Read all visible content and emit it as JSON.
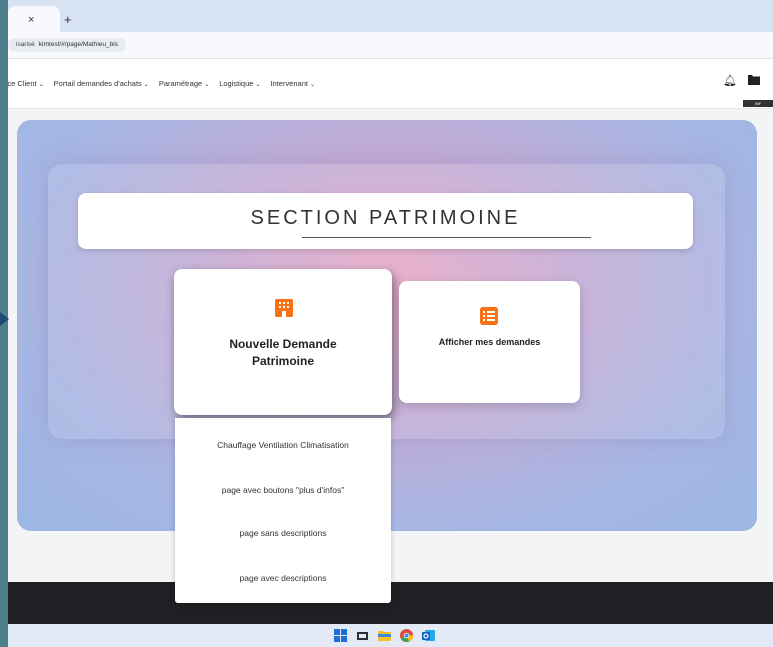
{
  "browser": {
    "tab_close": "×",
    "tab_new": "+",
    "address_prefix": "isarisé",
    "url": "kimtest/#/page/Mathieu_bis"
  },
  "nav": {
    "items": [
      {
        "label": "vice Client"
      },
      {
        "label": "Portail demandes d'achats"
      },
      {
        "label": "Paramétrage"
      },
      {
        "label": "Logistique"
      },
      {
        "label": "Intervenant"
      }
    ],
    "chevron": "⌄",
    "folder_badge": "INF"
  },
  "hero": {
    "title": "SECTION PATRIMOINE",
    "cards": [
      {
        "label": "Nouvelle Demande Patrimoine",
        "icon": "building-icon"
      },
      {
        "label": "Afficher mes demandes",
        "icon": "list-icon"
      }
    ]
  },
  "dropdown": {
    "items": [
      "Chauffage Ventilation Climatisation",
      "page avec boutons \"plus d'infos\"",
      "page sans descriptions",
      "page avec descriptions"
    ]
  },
  "colors": {
    "accent": "#f97316",
    "footer": "#1f2023",
    "taskbar": "#e3eaf5"
  },
  "taskbar": {
    "icons": [
      "windows-start-icon",
      "task-view-icon",
      "file-explorer-icon",
      "chrome-icon",
      "outlook-icon"
    ]
  }
}
